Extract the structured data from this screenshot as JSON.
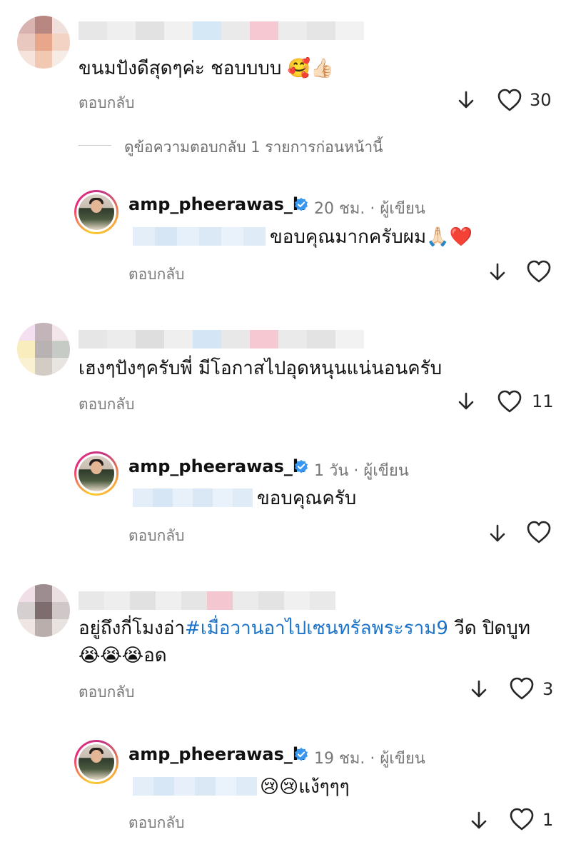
{
  "comments": [
    {
      "text": "ขนมปังดีสุดๆค่ะ ชอบบบบ",
      "emoji": "🥰👍🏻",
      "reply_label": "ตอบกลับ",
      "likes": "30"
    },
    {
      "text": "เฮงๆปังๆครับพี่ มีโอกาสไปอุดหนุนแน่นอนครับ",
      "reply_label": "ตอบกลับ",
      "likes": "11"
    },
    {
      "text_before": "อยู่ถึงกี่โมงอ่า",
      "hashtag": "#เมื่อวานอาไปเซนทรัลพระราม9",
      "text_after": " วีด ปิดบูท",
      "emoji_line": "😭😭😭",
      "text_line2": "อด",
      "reply_label": "ตอบกลับ",
      "likes": "3"
    }
  ],
  "view_previous": "ดูข้อความตอบกลับ 1 รายการก่อนหน้านี้",
  "replies": [
    {
      "author": "amp_pheerawas_k",
      "time": "20 ชม.",
      "role": "· ผู้เขียน",
      "text": "ขอบคุณมากครับผม",
      "emoji": "🙏🏻❤️",
      "reply_label": "ตอบกลับ",
      "likes": ""
    },
    {
      "author": "amp_pheerawas_k",
      "time": "1 วัน",
      "role": "· ผู้เขียน",
      "text": "ขอบคุณครับ",
      "reply_label": "ตอบกลับ",
      "likes": ""
    },
    {
      "author": "amp_pheerawas_k",
      "time": "19 ชม.",
      "role": "· ผู้เขียน",
      "emoji": "😢😢",
      "text": "แง้ๆๆๆ",
      "reply_label": "ตอบกลับ",
      "likes": "1"
    }
  ],
  "icons": {
    "down": "arrow-down-icon",
    "like": "heart-icon",
    "verified": "verified-badge-icon"
  },
  "colors": {
    "verified": "#3897f0",
    "hashtag": "#1a73c9",
    "secondary_text": "#7a7a7a"
  }
}
